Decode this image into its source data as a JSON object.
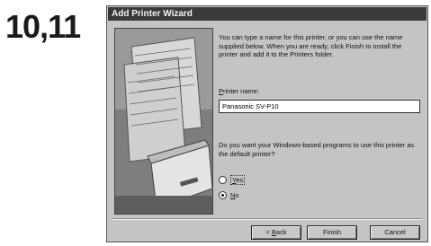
{
  "step_label": "10,11",
  "window": {
    "title": "Add Printer Wizard"
  },
  "intro_text": "You can type a name for this printer, or you can use the name supplied below. When you are ready, click Finish to install the printer and add it to the Printers folder.",
  "printer_name": {
    "label_prefix": "",
    "label_accel": "P",
    "label_rest": "rinter name:",
    "value": "Panasonic SV-P10"
  },
  "default_question": "Do you want your Windows-based programs to use this printer as the default printer?",
  "options": [
    {
      "accel": "Y",
      "rest": "es",
      "selected": false
    },
    {
      "accel": "N",
      "rest": "o",
      "selected": true
    }
  ],
  "buttons": {
    "back_prefix": "< ",
    "back_accel": "B",
    "back_rest": "ack",
    "finish": "Finish",
    "cancel": "Cancel"
  }
}
